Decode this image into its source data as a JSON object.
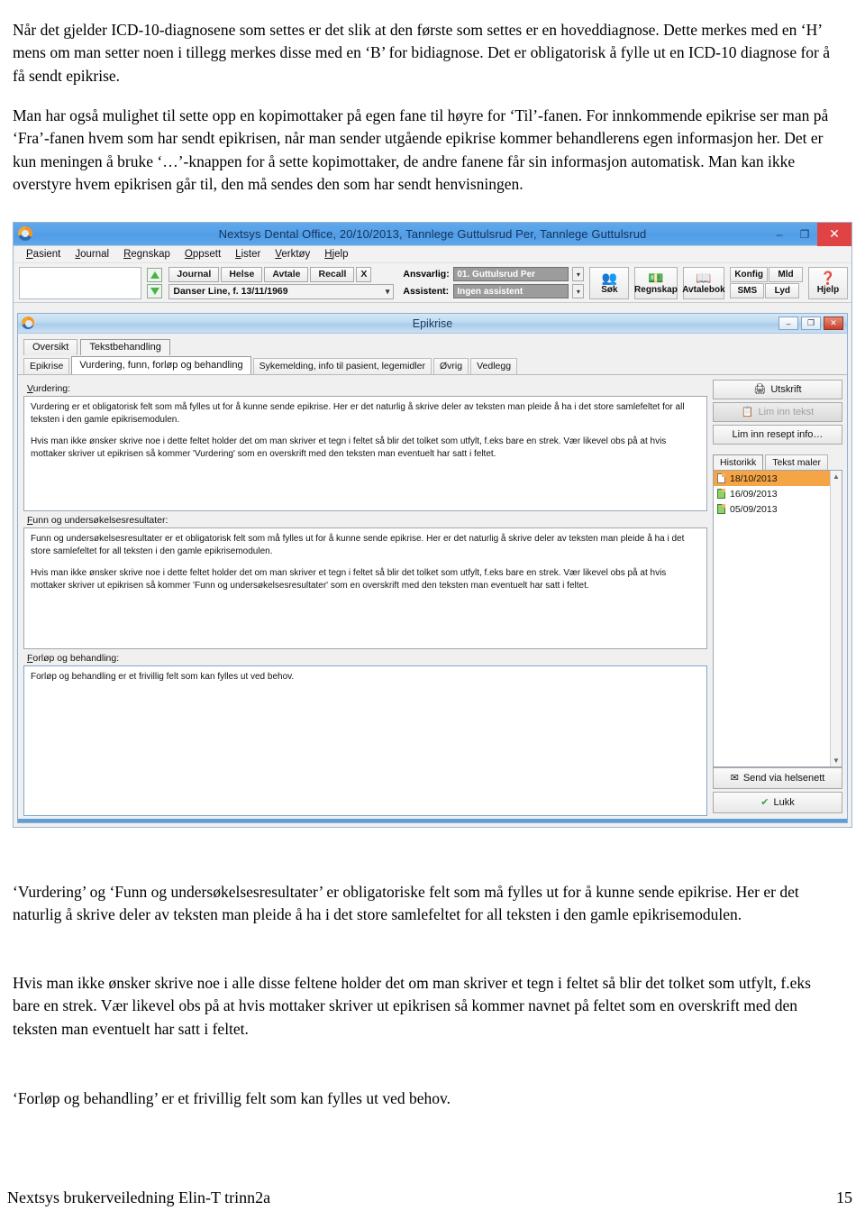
{
  "document": {
    "paragraph_1": "Når det gjelder ICD-10-diagnosene som settes er det slik at den første som settes er en hoveddiagnose. Dette merkes med en ‘H’ mens om man setter noen i tillegg merkes disse med en ‘B’ for bidiagnose. Det er obligatorisk å fylle ut en ICD-10 diagnose for å få sendt epikrise.",
    "paragraph_2": "Man har også mulighet til sette opp en kopimottaker på egen fane til høyre for ‘Til’-fanen. For innkommende epikrise ser man på ‘Fra’-fanen hvem som har sendt epikrisen, når man sender utgående epikrise kommer behandlerens egen informasjon her. Det er kun meningen å bruke ‘…’-knappen for å sette kopimottaker, de andre fanene får sin informasjon automatisk. Man kan ikke overstyre hvem epikrisen går til, den må sendes den som har sendt henvisningen.",
    "paragraph_3": "‘Vurdering’ og ‘Funn og undersøkelsesresultater’ er obligatoriske felt som må fylles ut for å kunne sende epikrise. Her er det naturlig å skrive deler av teksten man pleide å ha i det store samlefeltet for all teksten i den gamle epikrisemodulen.",
    "paragraph_4": "Hvis man ikke ønsker skrive noe i alle disse feltene holder det om man skriver et tegn i feltet så blir det tolket som utfylt, f.eks bare en strek. Vær likevel obs på at hvis mottaker skriver ut epikrisen så kommer navnet på feltet som en overskrift med den teksten man eventuelt har satt i feltet.",
    "paragraph_5": "‘Forløp og behandling’ er et frivillig felt som kan fylles ut ved behov.",
    "footer_left": "Nextsys brukerveiledning Elin-T trinn2a",
    "footer_page": "15"
  },
  "app": {
    "window_title": "Nextsys Dental Office,  20/10/2013, Tannlege Guttulsrud Per,  Tannlege Guttulsrud",
    "window_buttons": {
      "minimize": "–",
      "maximize": "❐",
      "close": "✕"
    },
    "menu": [
      {
        "label": "Pasient",
        "accel": "P"
      },
      {
        "label": "Journal",
        "accel": "J"
      },
      {
        "label": "Regnskap",
        "accel": "R"
      },
      {
        "label": "Oppsett",
        "accel": "O"
      },
      {
        "label": "Lister",
        "accel": "L"
      },
      {
        "label": "Verktøy",
        "accel": "V"
      },
      {
        "label": "Hjelp",
        "accel": "H"
      }
    ],
    "toolbar": {
      "patient_search_value": "",
      "patient_search_placeholder": "",
      "spinner_up": "up-triangle",
      "spinner_down": "down-triangle",
      "quick_buttons": [
        "Journal",
        "Helse",
        "Avtale",
        "Recall",
        "X"
      ],
      "patient_select_value": "Danser Line, f. 13/11/1969",
      "ansvarlig_label": "Ansvarlig:",
      "ansvarlig_value": "01. Guttulsrud Per",
      "assistent_label": "Assistent:",
      "assistent_value": "Ingen assistent",
      "big_buttons": [
        {
          "label": "Søk",
          "icon": "search-people-icon"
        },
        {
          "label": "Regnskap",
          "icon": "money-icon"
        },
        {
          "label": "Avtalebok",
          "icon": "book-icon"
        }
      ],
      "small_buttons": [
        "Konfig",
        "Mld",
        "SMS",
        "Lyd"
      ],
      "help_button": {
        "label": "Hjelp",
        "icon": "question-help-icon"
      }
    }
  },
  "epikrise": {
    "title": "Epikrise",
    "window_buttons": {
      "minimize": "–",
      "maximize": "❐",
      "close": "✕"
    },
    "top_tabs": [
      {
        "label": "Oversikt",
        "active": false
      },
      {
        "label": "Tekstbehandling",
        "active": true
      }
    ],
    "sub_tabs": [
      {
        "label": "Epikrise",
        "active": false
      },
      {
        "label": "Vurdering, funn, forløp og behandling",
        "active": true
      },
      {
        "label": "Sykemelding, info til pasient, legemidler",
        "active": false
      },
      {
        "label": "Øvrig",
        "active": false
      },
      {
        "label": "Vedlegg",
        "active": false
      }
    ],
    "fields": [
      {
        "label": "Vurdering:",
        "para_1": "Vurdering er et obligatorisk felt som må fylles ut for å kunne sende epikrise. Her er det naturlig å skrive deler av teksten man pleide å ha i det store samlefeltet for all teksten i den gamle epikrisemodulen.",
        "para_2": "Hvis man ikke ønsker skrive noe i dette feltet holder det om man skriver et tegn i feltet så blir det tolket som utfylt, f.eks bare en strek. Vær likevel obs på at hvis mottaker skriver ut epikrisen så kommer 'Vurdering' som en overskrift med den teksten man eventuelt har satt i feltet."
      },
      {
        "label": "Funn og undersøkelsesresultater:",
        "para_1": "Funn og undersøkelsesresultater er et obligatorisk felt som må fylles ut for å kunne sende epikrise. Her er det naturlig å skrive deler av teksten man pleide å ha i det store samlefeltet for all teksten i den gamle epikrisemodulen.",
        "para_2": "Hvis man ikke ønsker skrive noe i dette feltet holder det om man skriver et tegn i feltet så blir det tolket som utfylt, f.eks bare en strek. Vær likevel obs på at hvis mottaker skriver ut epikrisen så kommer 'Funn og undersøkelsesresultater' som en overskrift med den teksten man eventuelt har satt i feltet."
      },
      {
        "label": "Forløp og behandling:",
        "para_1": "Forløp og behandling er et frivillig felt som kan fylles ut ved behov.",
        "para_2": ""
      }
    ],
    "side_buttons": [
      {
        "label": "Utskrift",
        "icon": "printer-icon",
        "disabled": false
      },
      {
        "label": "Lim inn tekst",
        "icon": "paste-icon",
        "disabled": true
      },
      {
        "label": "Lim inn resept info…",
        "icon": "",
        "disabled": false
      }
    ],
    "history_tabs": [
      {
        "label": "Historikk",
        "active": true
      },
      {
        "label": "Tekst maler",
        "active": false
      }
    ],
    "history_items": [
      {
        "date": "18/10/2013",
        "selected": true,
        "icon": "document-icon"
      },
      {
        "date": "16/09/2013",
        "selected": false,
        "icon": "document-green-icon"
      },
      {
        "date": "05/09/2013",
        "selected": false,
        "icon": "document-green-icon"
      }
    ],
    "bottom_buttons": [
      {
        "label": "Send via helsenett",
        "icon": "envelope-send-icon"
      },
      {
        "label": "Lukk",
        "icon": "green-check-icon"
      }
    ]
  },
  "colors": {
    "titlebar_blue": "#53a0e8",
    "close_red": "#e04343",
    "selection_orange": "#f5a545",
    "inner_titlebar_blue": "#bcd9f0",
    "status_blue": "#5d9fd6"
  }
}
